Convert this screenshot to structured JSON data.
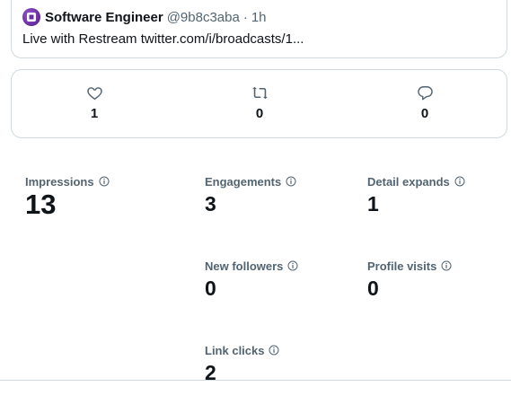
{
  "tweet": {
    "author_name": "Software Engineer",
    "author_handle": "@9b8c3aba",
    "separator": "·",
    "time": "1h",
    "text": "Live with Restream twitter.com/i/broadcasts/1..."
  },
  "actions": {
    "likes": "1",
    "retweets": "0",
    "replies": "0"
  },
  "metrics": {
    "impressions": {
      "label": "Impressions",
      "value": "13"
    },
    "engagements": {
      "label": "Engagements",
      "value": "3"
    },
    "detail_expands": {
      "label": "Detail expands",
      "value": "1"
    },
    "new_followers": {
      "label": "New followers",
      "value": "0"
    },
    "profile_visits": {
      "label": "Profile visits",
      "value": "0"
    },
    "link_clicks": {
      "label": "Link clicks",
      "value": "2"
    }
  },
  "colors": {
    "text_primary": "#0f1419",
    "text_secondary": "#536471",
    "border": "#cfd9de",
    "avatar": "#6a2fa3"
  },
  "icons": [
    "avatar-logo-icon",
    "heart-icon",
    "retweet-icon",
    "reply-icon",
    "info-icon"
  ]
}
